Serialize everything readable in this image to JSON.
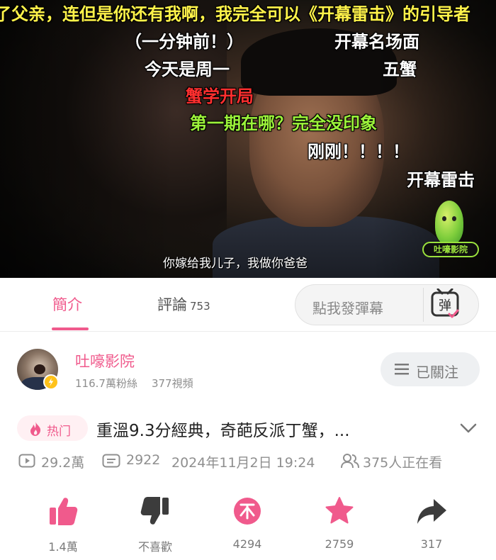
{
  "video": {
    "danmaku": [
      "了父亲，连但是你还有我啊，我完全可以《开幕雷击》的引导者",
      "（一分钟前！）",
      "开幕名场面",
      "今天是周一",
      "五蟹",
      "蟹学开局",
      "第一期在哪？完全没印象",
      "刚刚！！！！",
      "开幕雷击"
    ],
    "subtitle": "你嫁给我儿子，我做你爸爸",
    "watermark": "吐嚎影院"
  },
  "tabs": {
    "intro_label": "簡介",
    "comments_label": "評論",
    "comments_count": "753",
    "danmaku_placeholder": "點我發彈幕",
    "danmaku_btn_glyph": "弹"
  },
  "uploader": {
    "name": "吐嚎影院",
    "followers": "116.7萬粉絲",
    "videos": "377視頻",
    "follow_label": "已關注"
  },
  "video_info": {
    "hot_label": "热门",
    "title": "重溫9.3分經典，奇葩反派丁蟹，...",
    "views": "29.2萬",
    "danmaku_count": "2922",
    "date": "2024年11月2日 19:24",
    "watching": "375人正在看"
  },
  "actions": {
    "like_count": "1.4萬",
    "dislike_label": "不喜歡",
    "coin_count": "4294",
    "fav_count": "2759",
    "share_count": "317"
  },
  "colors": {
    "accent": "#f05a8c",
    "danmaku_yellow": "#fff34a",
    "danmaku_red": "#ff2f2f",
    "danmaku_green": "#9cf23a"
  }
}
